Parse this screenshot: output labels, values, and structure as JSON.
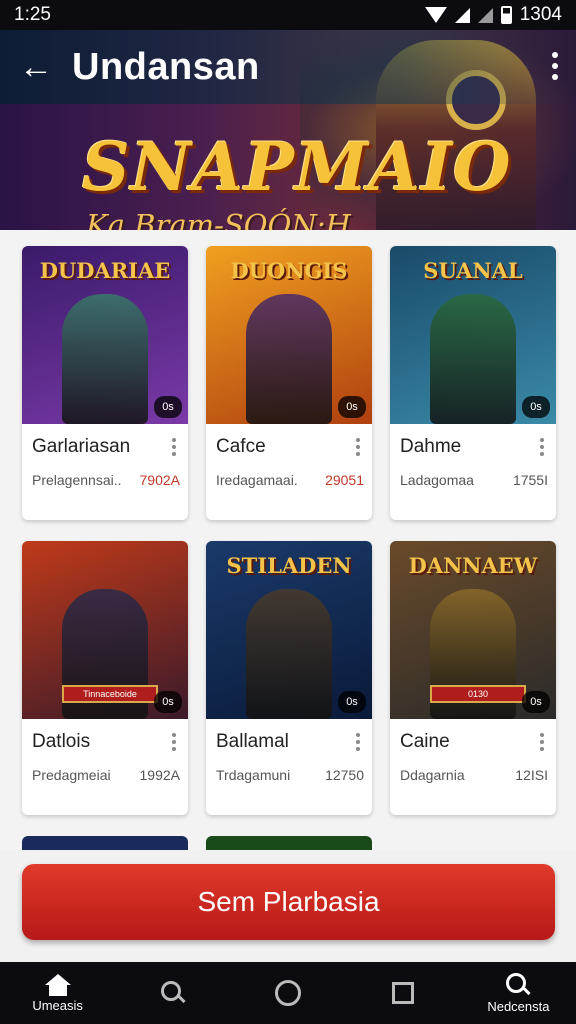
{
  "status": {
    "time": "1:25",
    "right_text": "1304"
  },
  "appbar": {
    "title": "Undansan",
    "back_icon": "back-arrow-icon",
    "menu_icon": "more-vertical-icon"
  },
  "hero": {
    "title": "SNAPMAIO",
    "subtitle": "Ka Bram-SOÓN:H"
  },
  "cards": [
    {
      "art_title": "DUDARIAE",
      "title": "Garlariasan",
      "meta": "Prelagennsai..",
      "price": "7902A",
      "badge": "0s",
      "colors": [
        "#3a1a6a",
        "#7a3aa8"
      ],
      "figure": "#3a7a6a"
    },
    {
      "art_title": "DUONGIS",
      "title": "Cafce",
      "meta": "Iredagamaai.",
      "price": "29051",
      "badge": "0s",
      "colors": [
        "#f0a020",
        "#b04010"
      ],
      "figure": "#4a2a6a"
    },
    {
      "art_title": "SUANAL",
      "title": "Dahme",
      "meta": "Ladagomaa",
      "price": "1755I",
      "badge": "0s",
      "colors": [
        "#1a4a6a",
        "#3a8aa8"
      ],
      "figure": "#2a6a3a"
    },
    {
      "art_title": "",
      "title": "Datlois",
      "meta": "Predagmeiai",
      "price": "1992A",
      "badge": "0s",
      "colors": [
        "#c03a1a",
        "#3a1a2a"
      ],
      "figure": "#2a2a4a",
      "banner": "Tinnaceboide"
    },
    {
      "art_title": "STILADEN",
      "title": "Ballamal",
      "meta": "Trdagamuni",
      "price": "12750",
      "badge": "0s",
      "colors": [
        "#1a3a6a",
        "#0a1a3a"
      ],
      "figure": "#4a3a2a"
    },
    {
      "art_title": "DANNAEW",
      "title": "Caine",
      "meta": "Ddagarnia",
      "price": "12ISI",
      "badge": "0s",
      "colors": [
        "#6a4a2a",
        "#2a2a2a"
      ],
      "figure": "#8a6a2a",
      "banner": "0130"
    }
  ],
  "cta": {
    "label": "Sem Plarbasia"
  },
  "nav": {
    "home_label": "Umeasis",
    "right_label": "Nedcensta"
  }
}
